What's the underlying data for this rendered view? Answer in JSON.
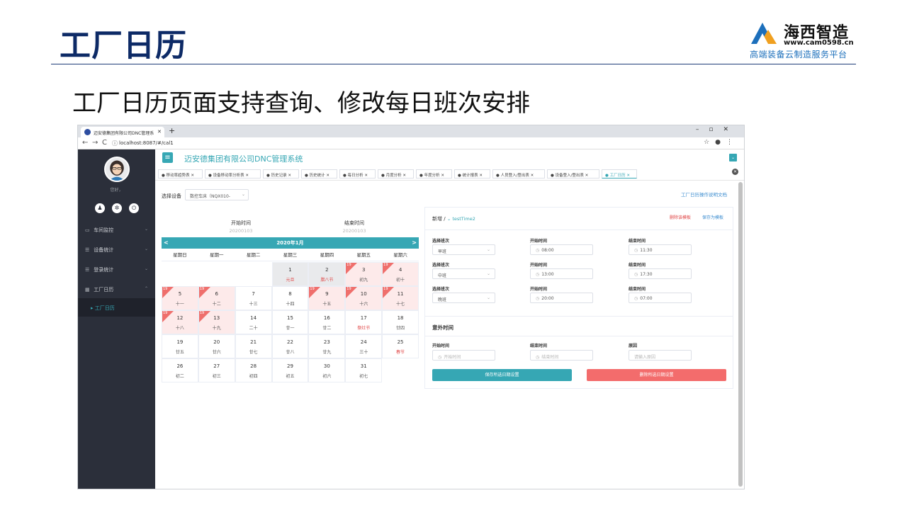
{
  "slide": {
    "title": "工厂日历",
    "subtitle": "工厂日历页面支持查询、修改每日班次安排",
    "brand_name": "海西智造",
    "brand_url": "www.cam0598.cn",
    "brand_slogan": "高端装备云制造服务平台"
  },
  "browser": {
    "tab_title": "迈安德集团有限公司DNC管理系",
    "url": "localhost:8087/#/cal1"
  },
  "app": {
    "title": "迈安德集团有限公司DNC管理系统",
    "greeting": "您好，",
    "menu": [
      {
        "label": "车间监控"
      },
      {
        "label": "设备统计"
      },
      {
        "label": "登录统计"
      },
      {
        "label": "工厂日历"
      }
    ],
    "submenu_active": "工厂日历",
    "page_tabs": [
      "移动率趋势表",
      "设备移动率分析表",
      "历史记录",
      "历史统计",
      "每日分析",
      "月度分析",
      "年度分析",
      "统计报表",
      "人员登入/登出表",
      "设备登入/登出表",
      "工厂日历"
    ],
    "filter_label": "选择设备",
    "filter_value": "数控车床（NQX010-",
    "help_link": "工厂日历操作说明文档",
    "range": {
      "start_label": "开始时间",
      "start_value": "20200103",
      "end_label": "结束时间",
      "end_value": "20200103"
    }
  },
  "calendar": {
    "month": "2020年1月",
    "prev": "<",
    "next": ">",
    "weekdays": [
      "星期日",
      "星期一",
      "星期二",
      "星期三",
      "星期四",
      "星期五",
      "星期六"
    ],
    "badge": "19",
    "days": [
      {
        "d": "1",
        "l": "元旦",
        "red": true,
        "bg": "grey",
        "badge": false
      },
      {
        "d": "2",
        "l": "腊八节",
        "red": true,
        "bg": "grey",
        "badge": false
      },
      {
        "d": "3",
        "l": "初九",
        "red": false,
        "bg": "pink",
        "badge": true
      },
      {
        "d": "4",
        "l": "初十",
        "red": false,
        "bg": "pink",
        "badge": true
      },
      {
        "d": "5",
        "l": "十一",
        "red": false,
        "bg": "pink",
        "badge": true
      },
      {
        "d": "6",
        "l": "十二",
        "red": false,
        "bg": "pink",
        "badge": true
      },
      {
        "d": "7",
        "l": "十三",
        "red": false,
        "bg": "",
        "badge": false
      },
      {
        "d": "8",
        "l": "十四",
        "red": false,
        "bg": "",
        "badge": false
      },
      {
        "d": "9",
        "l": "十五",
        "red": false,
        "bg": "pink",
        "badge": true
      },
      {
        "d": "10",
        "l": "十六",
        "red": false,
        "bg": "pink",
        "badge": true
      },
      {
        "d": "11",
        "l": "十七",
        "red": false,
        "bg": "pink",
        "badge": true
      },
      {
        "d": "12",
        "l": "十八",
        "red": false,
        "bg": "pink",
        "badge": true
      },
      {
        "d": "13",
        "l": "十九",
        "red": false,
        "bg": "pink",
        "badge": true
      },
      {
        "d": "14",
        "l": "二十",
        "red": false,
        "bg": "",
        "badge": false
      },
      {
        "d": "15",
        "l": "廿一",
        "red": false,
        "bg": "",
        "badge": false
      },
      {
        "d": "16",
        "l": "廿二",
        "red": false,
        "bg": "",
        "badge": false
      },
      {
        "d": "17",
        "l": "祭灶节",
        "red": true,
        "bg": "",
        "badge": false
      },
      {
        "d": "18",
        "l": "廿四",
        "red": false,
        "bg": "",
        "badge": false
      },
      {
        "d": "19",
        "l": "廿五",
        "red": false,
        "bg": "",
        "badge": false
      },
      {
        "d": "20",
        "l": "廿六",
        "red": false,
        "bg": "",
        "badge": false
      },
      {
        "d": "21",
        "l": "廿七",
        "red": false,
        "bg": "",
        "badge": false
      },
      {
        "d": "22",
        "l": "廿八",
        "red": false,
        "bg": "",
        "badge": false
      },
      {
        "d": "23",
        "l": "廿九",
        "red": false,
        "bg": "",
        "badge": false
      },
      {
        "d": "24",
        "l": "三十",
        "red": false,
        "bg": "",
        "badge": false
      },
      {
        "d": "25",
        "l": "春节",
        "red": true,
        "bg": "",
        "badge": false
      },
      {
        "d": "26",
        "l": "初二",
        "red": false,
        "bg": "",
        "badge": false
      },
      {
        "d": "27",
        "l": "初三",
        "red": false,
        "bg": "",
        "badge": false
      },
      {
        "d": "28",
        "l": "初四",
        "red": false,
        "bg": "",
        "badge": false
      },
      {
        "d": "29",
        "l": "初五",
        "red": false,
        "bg": "",
        "badge": false
      },
      {
        "d": "30",
        "l": "初六",
        "red": false,
        "bg": "",
        "badge": false
      },
      {
        "d": "31",
        "l": "初七",
        "red": false,
        "bg": "",
        "badge": false
      }
    ]
  },
  "panel": {
    "title_prefix": "新增 / ",
    "title_template": "testTime2",
    "delete_template": "删除该模板",
    "save_template": "保存为模板",
    "shift_label": "选择班次",
    "start_label": "开始时间",
    "end_label": "结束时间",
    "shifts": [
      {
        "name": "早班",
        "start": "08:00",
        "end": "11:30"
      },
      {
        "name": "中班",
        "start": "13:00",
        "end": "17:30"
      },
      {
        "name": "晚班",
        "start": "20:00",
        "end": "07:00"
      }
    ],
    "extra_title": "意外时间",
    "extra_start_label": "开始时间",
    "extra_end_label": "结束时间",
    "extra_reason_label": "原因",
    "extra_start_ph": "开始时间",
    "extra_end_ph": "结束时间",
    "extra_reason_ph": "请输入原因",
    "save_button": "保存所选日期设置",
    "delete_button": "删除所选日期设置"
  },
  "colors": {
    "accent": "#36a7b4",
    "danger": "#f36c6c",
    "title": "#0d2a66",
    "sidebar": "#2b2f3a"
  }
}
